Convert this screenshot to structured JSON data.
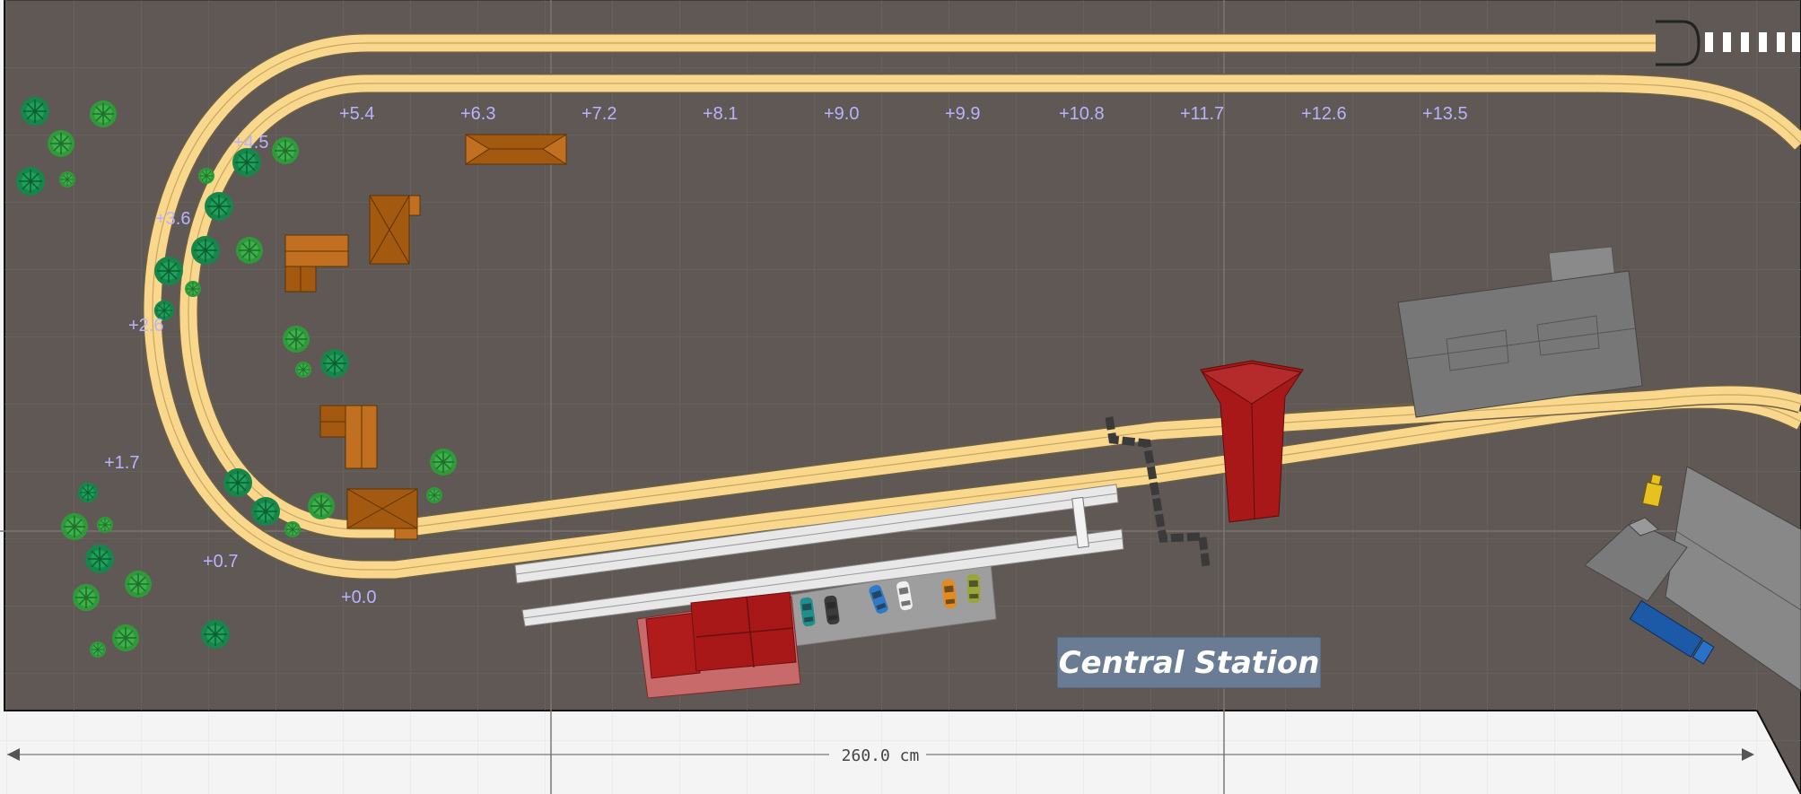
{
  "elevations": [
    "+0.0",
    "+0.7",
    "+1.7",
    "+2.6",
    "+3.6",
    "+4.5",
    "+5.4",
    "+6.3",
    "+7.2",
    "+8.1",
    "+9.0",
    "+9.9",
    "+10.8",
    "+11.7",
    "+12.6",
    "+13.5"
  ],
  "station_sign": "Central Station",
  "dimension_label": "260.0 cm",
  "colors": {
    "baseboard": "#5f5854",
    "track_rail": "#f9d78c",
    "track_edge": "#7a6a48",
    "elevation_text": "#b9b3ff",
    "station_sign_bg": "#6a7c93",
    "building_brown": "#a3590f",
    "station_red": "#a81818",
    "industrial_grey": "#777777"
  },
  "icons": [
    "buffer-stop-icon",
    "tree-icon",
    "car-icon",
    "truck-icon",
    "forklift-icon",
    "dimension-arrow-icon"
  ]
}
